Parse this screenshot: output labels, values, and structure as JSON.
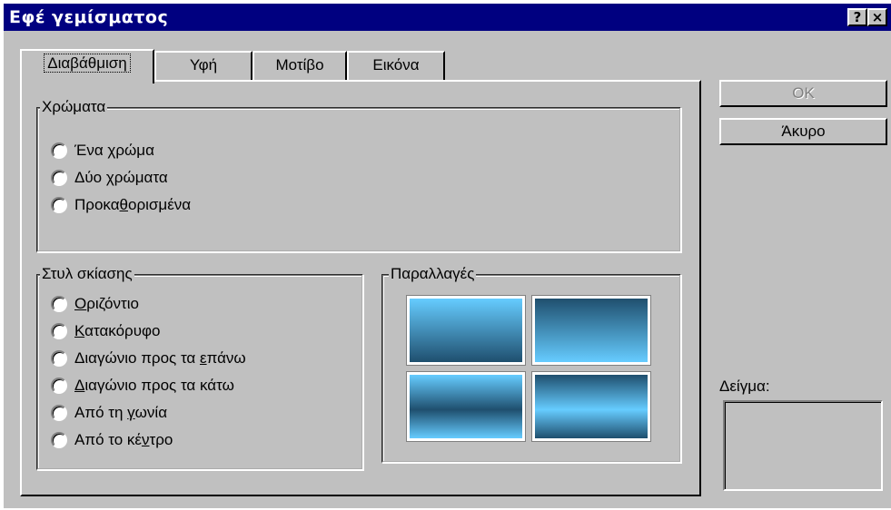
{
  "window": {
    "title": "Εφέ γεμίσματος",
    "help_button": "?",
    "close_button": "×"
  },
  "tabs": [
    {
      "label": "Διαβάθμιση",
      "active": true
    },
    {
      "label": "Υφή",
      "active": false
    },
    {
      "label": "Μοτίβο",
      "active": false
    },
    {
      "label": "Εικόνα",
      "active": false
    }
  ],
  "colors_group": {
    "legend": "Χρώματα",
    "options": [
      {
        "pre": "Ένα ",
        "u": "χ",
        "post": "ρώμα"
      },
      {
        "pre": "Δύο ",
        "u": "χ",
        "post": "ρώματα"
      },
      {
        "pre": "Προκα",
        "u": "θ",
        "post": "ορισμένα"
      }
    ]
  },
  "shading_group": {
    "legend": "Στυλ σκίασης",
    "options": [
      {
        "pre": "",
        "u": "Ο",
        "post": "ριζόντιο"
      },
      {
        "pre": "",
        "u": "Κ",
        "post": "ατακόρυφο"
      },
      {
        "pre": "Διαγώνιο προς τα ",
        "u": "ε",
        "post": "πάνω"
      },
      {
        "pre": "",
        "u": "Δ",
        "post": "ιαγώνιο προς τα κάτω"
      },
      {
        "pre": "Από τη ",
        "u": "γ",
        "post": "ωνία"
      },
      {
        "pre": "Από το κέ",
        "u": "ν",
        "post": "τρο"
      }
    ]
  },
  "variants_group": {
    "legend": "Παραλλαγές",
    "gradient_colors": [
      "#66ccff",
      "#1f4f6e"
    ]
  },
  "buttons": {
    "ok": "OK",
    "cancel": "Άκυρο"
  },
  "sample": {
    "label": "Δείγμα:"
  },
  "theme": {
    "title_bar": "#000080",
    "face": "#c0c0c0"
  }
}
